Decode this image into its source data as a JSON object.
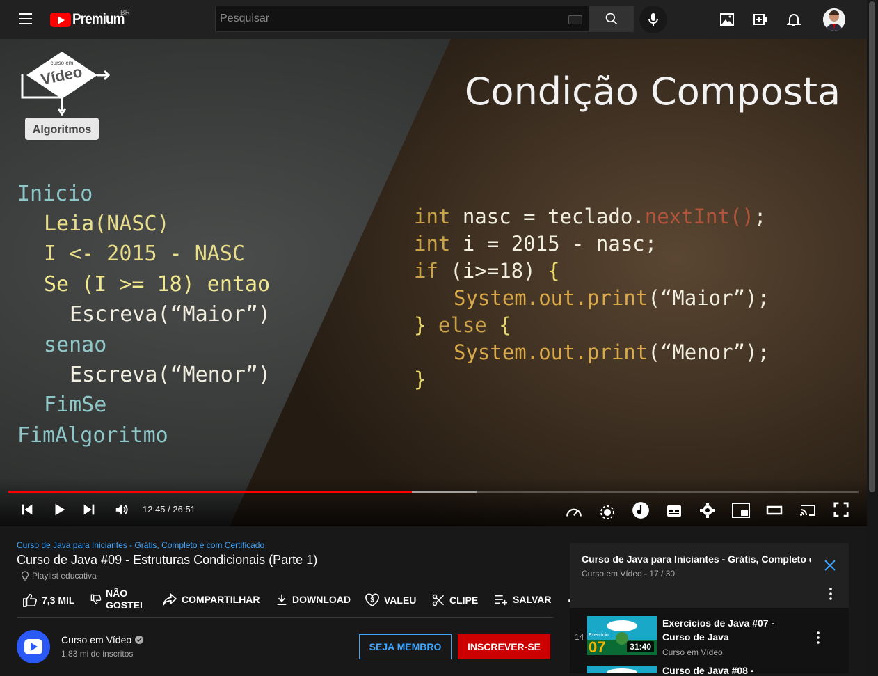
{
  "header": {
    "logo_text": "Premium",
    "country": "BR",
    "search_placeholder": "Pesquisar"
  },
  "video": {
    "slide_title": "Condição Composta",
    "logo_word": "Vídeo",
    "logo_small": "curso em",
    "logo_badge": "Algoritmos",
    "pseudocode": [
      "Inicio",
      "Leia(NASC)",
      "I <- 2015 - NASC",
      "Se (I >= 18) entao",
      "Escreva(“Maior”)",
      "senao",
      "Escreva(“Menor”)",
      "FimSe",
      "FimAlgoritmo"
    ],
    "java_code": {
      "l1_kw": "int",
      "l1_a": " nasc = teclado.",
      "l1_m": "nextInt()",
      "l1_e": ";",
      "l2_kw": "int",
      "l2_a": " i = 2015 - nasc;",
      "l3_kw": "if",
      "l3_a": " (i>=18) ",
      "l3_b": "{",
      "l4_s": "System.out.print",
      "l4_a": "(“Maior”);",
      "l5_a": "} ",
      "l5_kw": "else",
      "l5_b": " {",
      "l6_s": "System.out.print",
      "l6_a": "(“Menor”);",
      "l7_a": "}"
    },
    "progress_fraction": 0.475,
    "buffered_fraction": 0.551,
    "time_display": "12:45 / 26:51"
  },
  "info": {
    "playlist_link": "Curso de Java para Iniciantes - Grátis, Completo e com Certificado",
    "title": "Curso de Java #09 - Estruturas Condicionais (Parte 1)",
    "edu_label": "Playlist educativa",
    "likes": "7,3 MIL",
    "dislike_label_1": "NÃO",
    "dislike_label_2": "GOSTEI",
    "share_label": "COMPARTILHAR",
    "download_label": "DOWNLOAD",
    "thanks_label": "VALEU",
    "clip_label": "CLIPE",
    "save_label": "SALVAR",
    "more_label": "..."
  },
  "channel": {
    "name": "Curso em Vídeo",
    "subscribers": "1,83 mi de inscritos",
    "member_button": "SEJA MEMBRO",
    "subscribe_button": "INSCREVER-SE"
  },
  "playlist": {
    "name": "Curso de Java para Iniciantes - Grátis, Completo e ...",
    "meta": "Curso em Vídeo - 17 / 30",
    "items": [
      {
        "index": "14",
        "title": "Exercícios de Java #07 - Curso de Java",
        "channel": "Curso em Vídeo",
        "duration": "31:40",
        "thumb_text": "Exercício",
        "thumb_num": "07"
      },
      {
        "title": "Curso de Java #08 -"
      }
    ]
  },
  "colors": {
    "accent_red": "#ff0000",
    "link_blue": "#3ea6ff",
    "subscribe_red": "#cc0000"
  }
}
